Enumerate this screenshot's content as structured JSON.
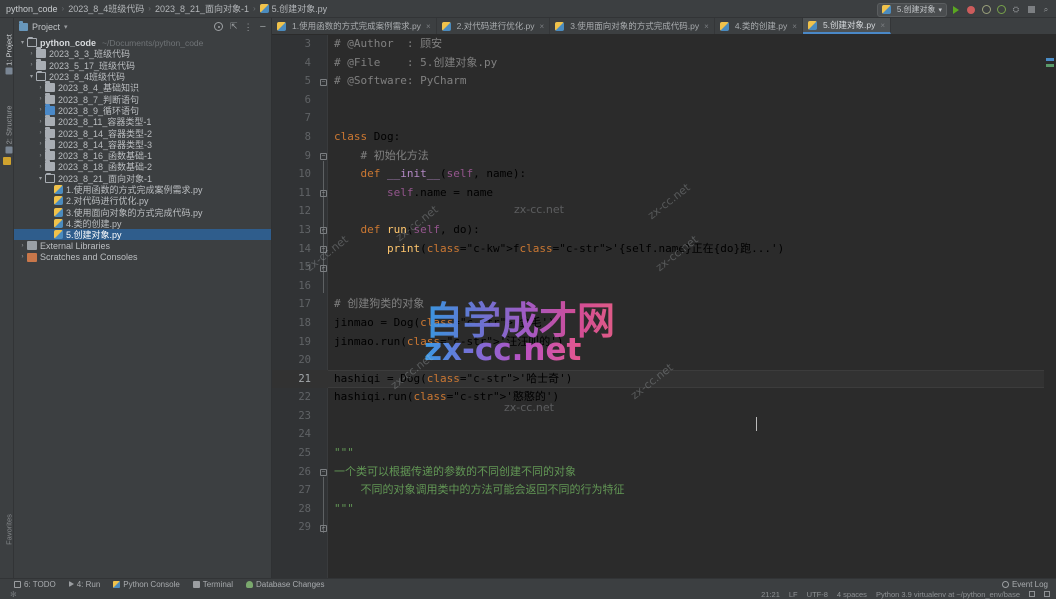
{
  "breadcrumb": {
    "items": [
      "python_code",
      "2023_8_4班级代码",
      "2023_8_21_面向对象-1",
      "5.创建对象.py"
    ],
    "separator": "›"
  },
  "toolbar": {
    "run_config_label": "5.创建对象",
    "chevron": "▾",
    "icons": [
      "run-icon",
      "debug-icon",
      "coverage-icon",
      "profile-icon",
      "build-icon",
      "stop-icon",
      "search-icon"
    ]
  },
  "vertical_strip": {
    "project_label": "1: Project",
    "structure_label": "2: Structure",
    "favorites_label": "Favorites"
  },
  "project_panel": {
    "title": "Project",
    "chevron": "▾",
    "actions": [
      "gear-icon",
      "collapse-all-icon",
      "more-options-icon",
      "hide-icon"
    ],
    "tree": [
      {
        "depth": 0,
        "arrow": "▾",
        "icon": "folder-open",
        "label": "python_code",
        "path": "~/Documents/python_code",
        "bold": true,
        "selected": false
      },
      {
        "depth": 1,
        "arrow": "›",
        "icon": "folder",
        "label": "2023_3_3_班级代码",
        "path": "",
        "bold": false,
        "selected": false
      },
      {
        "depth": 1,
        "arrow": "›",
        "icon": "folder",
        "label": "2023_5_17_班级代码",
        "path": "",
        "bold": false,
        "selected": false
      },
      {
        "depth": 1,
        "arrow": "▾",
        "icon": "folder-open",
        "label": "2023_8_4班级代码",
        "path": "",
        "bold": false,
        "selected": false
      },
      {
        "depth": 2,
        "arrow": "›",
        "icon": "folder",
        "label": "2023_8_4_基础知识",
        "path": "",
        "bold": false,
        "selected": false
      },
      {
        "depth": 2,
        "arrow": "›",
        "icon": "folder",
        "label": "2023_8_7_判断语句",
        "path": "",
        "bold": false,
        "selected": false
      },
      {
        "depth": 2,
        "arrow": "›",
        "icon": "folder-blue",
        "label": "2023_8_9_循环语句",
        "path": "",
        "bold": false,
        "selected": false
      },
      {
        "depth": 2,
        "arrow": "›",
        "icon": "folder",
        "label": "2023_8_11_容器类型-1",
        "path": "",
        "bold": false,
        "selected": false
      },
      {
        "depth": 2,
        "arrow": "›",
        "icon": "folder",
        "label": "2023_8_14_容器类型-2",
        "path": "",
        "bold": false,
        "selected": false
      },
      {
        "depth": 2,
        "arrow": "›",
        "icon": "folder",
        "label": "2023_8_14_容器类型-3",
        "path": "",
        "bold": false,
        "selected": false
      },
      {
        "depth": 2,
        "arrow": "›",
        "icon": "folder",
        "label": "2023_8_16_函数基础-1",
        "path": "",
        "bold": false,
        "selected": false
      },
      {
        "depth": 2,
        "arrow": "›",
        "icon": "folder",
        "label": "2023_8_18_函数基础-2",
        "path": "",
        "bold": false,
        "selected": false
      },
      {
        "depth": 2,
        "arrow": "▾",
        "icon": "folder-open",
        "label": "2023_8_21_面向对象-1",
        "path": "",
        "bold": false,
        "selected": false
      },
      {
        "depth": 3,
        "arrow": "",
        "icon": "python-file",
        "label": "1.使用函数的方式完成案例需求.py",
        "path": "",
        "bold": false,
        "selected": false
      },
      {
        "depth": 3,
        "arrow": "",
        "icon": "python-file",
        "label": "2.对代码进行优化.py",
        "path": "",
        "bold": false,
        "selected": false
      },
      {
        "depth": 3,
        "arrow": "",
        "icon": "python-file",
        "label": "3.使用面向对象的方式完成代码.py",
        "path": "",
        "bold": false,
        "selected": false
      },
      {
        "depth": 3,
        "arrow": "",
        "icon": "python-file",
        "label": "4.类的创建.py",
        "path": "",
        "bold": false,
        "selected": false
      },
      {
        "depth": 3,
        "arrow": "",
        "icon": "python-file",
        "label": "5.创建对象.py",
        "path": "",
        "bold": false,
        "selected": true
      },
      {
        "depth": 0,
        "arrow": "›",
        "icon": "library",
        "label": "External Libraries",
        "path": "",
        "bold": false,
        "selected": false
      },
      {
        "depth": 0,
        "arrow": "›",
        "icon": "scratches",
        "label": "Scratches and Consoles",
        "path": "",
        "bold": false,
        "selected": false
      }
    ]
  },
  "editor": {
    "tabs": [
      {
        "label": "1.使用函数的方式完成案例需求.py",
        "active": false,
        "close": "×"
      },
      {
        "label": "2.对代码进行优化.py",
        "active": false,
        "close": "×"
      },
      {
        "label": "3.使用面向对象的方式完成代码.py",
        "active": false,
        "close": "×"
      },
      {
        "label": "4.类的创建.py",
        "active": false,
        "close": "×"
      },
      {
        "label": "5.创建对象.py",
        "active": true,
        "close": "×"
      }
    ],
    "lines": [
      {
        "no": "3",
        "text": "# @Author  : 顾安"
      },
      {
        "no": "4",
        "text": "# @File    : 5.创建对象.py"
      },
      {
        "no": "5",
        "text": "# @Software: PyCharm"
      },
      {
        "no": "6",
        "text": ""
      },
      {
        "no": "7",
        "text": ""
      },
      {
        "no": "8",
        "text": "class Dog:"
      },
      {
        "no": "9",
        "text": "    # 初始化方法"
      },
      {
        "no": "10",
        "text": "    def __init__(self, name):"
      },
      {
        "no": "11",
        "text": "        self.name = name"
      },
      {
        "no": "12",
        "text": ""
      },
      {
        "no": "13",
        "text": "    def run(self, do):"
      },
      {
        "no": "14",
        "text": "        print(f'{self.name}正在{do}跑...')"
      },
      {
        "no": "15",
        "text": ""
      },
      {
        "no": "16",
        "text": ""
      },
      {
        "no": "17",
        "text": "# 创建狗类的对象"
      },
      {
        "no": "18",
        "text": "jinmao = Dog('金毛')"
      },
      {
        "no": "19",
        "text": "jinmao.run('汪汪叫的')"
      },
      {
        "no": "20",
        "text": ""
      },
      {
        "no": "21",
        "text": "hashiqi = Dog('哈士奇')"
      },
      {
        "no": "22",
        "text": "hashiqi.run('憨憨的')"
      },
      {
        "no": "23",
        "text": ""
      },
      {
        "no": "24",
        "text": ""
      },
      {
        "no": "25",
        "text": "\"\"\""
      },
      {
        "no": "26",
        "text": "一个类可以根据传递的参数的不同创建不同的对象"
      },
      {
        "no": "27",
        "text": "    不同的对象调用类中的方法可能会返回不同的行为特征"
      },
      {
        "no": "28",
        "text": "\"\"\""
      },
      {
        "no": "29",
        "text": ""
      }
    ],
    "current_line": "21"
  },
  "watermarks": {
    "main": "自学成才网",
    "sub": "zx-cc.net",
    "tile": "zx-cc.net"
  },
  "bottom_bar": {
    "items": [
      {
        "label": "6: TODO",
        "icon": "todo-icon"
      },
      {
        "label": "4: Run",
        "icon": "run-icon"
      },
      {
        "label": "Python Console",
        "icon": "python-icon"
      },
      {
        "label": "Terminal",
        "icon": "terminal-icon"
      },
      {
        "label": "Database Changes",
        "icon": "database-icon"
      }
    ],
    "event_log": "Event Log"
  },
  "status_bar": {
    "caret_position": "21:21",
    "line_separator": "LF",
    "encoding": "UTF-8",
    "indent": "4 spaces",
    "interpreter": "Python 3.9 virtualenv at ~/python_env/base"
  }
}
